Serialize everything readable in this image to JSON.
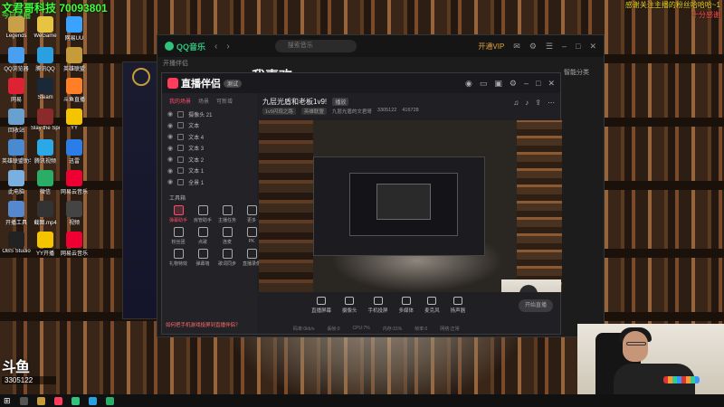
{
  "overlay": {
    "stream_id_line": "文君哥科技 70093801",
    "stream_sub": "今日主播",
    "right_note_1": "感谢关注主播的粉丝哈哈哈~1",
    "right_note_2": "十分感谢",
    "room_logo": "斗鱼",
    "room_number": "3305122"
  },
  "desktop_icons": [
    {
      "label": "Legends",
      "color": "#c8a04a"
    },
    {
      "label": "WeGame",
      "color": "#e6c341"
    },
    {
      "label": "网易UU",
      "color": "#3aa3ff"
    },
    {
      "label": "QQ浏览器",
      "color": "#4aa0f0"
    },
    {
      "label": "腾讯QQ",
      "color": "#2aa0e0"
    },
    {
      "label": "英雄联盟",
      "color": "#c69b3a"
    },
    {
      "label": "网易",
      "color": "#d23"
    },
    {
      "label": "Steam",
      "color": "#1b2838"
    },
    {
      "label": "斗鱼直播",
      "color": "#ff7f27"
    },
    {
      "label": "回收站",
      "color": "#6aa0d0"
    },
    {
      "label": "Slay the Spire",
      "color": "#8b2a2a"
    },
    {
      "label": "YY",
      "color": "#f5c400"
    },
    {
      "label": "英雄联盟助手",
      "color": "#4a8ad0"
    },
    {
      "label": "腾讯视频",
      "color": "#2aa8e8"
    },
    {
      "label": "迅雷",
      "color": "#2b7de9"
    },
    {
      "label": "此电脑",
      "color": "#7ab0e0"
    },
    {
      "label": "微信",
      "color": "#2aae67"
    },
    {
      "label": "网易云音乐",
      "color": "#e03"
    },
    {
      "label": "开播工具",
      "color": "#58c"
    },
    {
      "label": "截图.mp4",
      "color": "#333"
    },
    {
      "label": "视频",
      "color": "#444"
    },
    {
      "label": "OBS Studio",
      "color": "#222"
    },
    {
      "label": "YY开播",
      "color": "#f5c400"
    },
    {
      "label": "网易云音乐",
      "color": "#e03"
    }
  ],
  "qq_music": {
    "brand": "QQ音乐",
    "search_placeholder": "搜索音乐",
    "section": "我喜欢",
    "top_label": "开播伴侣",
    "vip": "开通VIP",
    "manage": "智能分类"
  },
  "zhibo": {
    "brand": "直播伴侣",
    "tag": "测试",
    "tabs": [
      "我的场景",
      "场景",
      "可新增"
    ],
    "layers": [
      "摄像头 21",
      "文本",
      "文本 4",
      "文本 3",
      "文本 2",
      "文本 1",
      "全景 1"
    ],
    "tools_title": "工具箱",
    "tools": [
      {
        "label": "弹幕助手",
        "red": true
      },
      {
        "label": "房管助手",
        "red": false
      },
      {
        "label": "主播任务",
        "red": false
      },
      {
        "label": "更多",
        "red": false
      },
      {
        "label": "粉丝团",
        "red": false
      },
      {
        "label": "点歌",
        "red": false
      },
      {
        "label": "连麦",
        "red": false
      },
      {
        "label": "PK",
        "red": false
      },
      {
        "label": "礼物特效",
        "red": false
      },
      {
        "label": "弹幕墙",
        "red": false
      },
      {
        "label": "歌词同步",
        "red": false
      },
      {
        "label": "直播录像",
        "red": false
      }
    ],
    "notice": "如何把手机游戏投屏到直播伴侣？",
    "room_title": "九层光盾和老板1v9!",
    "room_badge": "播放",
    "room_category": "1v9闪现之路",
    "room_tag": "英雄联盟",
    "room_author": "九层光盾的文君哥",
    "room_id": "3305122",
    "room_fans": "416728",
    "bottom_buttons": [
      "直播屏幕",
      "摄像头",
      "手机投屏",
      "多媒体",
      "麦克风",
      "扬声器"
    ],
    "start_button": "开始直播",
    "status": [
      "码率:0kb/s",
      "丢帧:0",
      "CPU:7%",
      "内存:31%",
      "帧率:0",
      "网络:正常"
    ]
  }
}
